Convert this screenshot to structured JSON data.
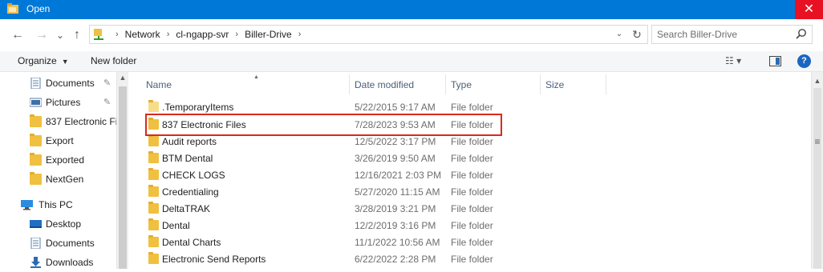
{
  "window": {
    "title": "Open",
    "close_glyph": "✕"
  },
  "nav": {
    "back_glyph": "←",
    "forward_glyph": "→",
    "recent_glyph": "⌄",
    "up_glyph": "↑",
    "breadcrumb": [
      "Network",
      "cl-ngapp-svr",
      "Biller-Drive"
    ],
    "breadcrumb_sep": "›",
    "dropdown_glyph": "⌄",
    "refresh_glyph": "↻"
  },
  "search": {
    "placeholder": "Search Biller-Drive"
  },
  "toolbar": {
    "organize_label": "Organize",
    "organize_caret": "▼",
    "new_folder_label": "New folder",
    "views_label": "☷ ▾",
    "help_label": "?"
  },
  "navpane": {
    "pin_glyph": "✎",
    "items": [
      {
        "label": "Documents",
        "icon": "documents-icon",
        "pinned": true
      },
      {
        "label": "Pictures",
        "icon": "pictures-icon",
        "pinned": true
      },
      {
        "label": "837 Electronic Fi",
        "icon": "folder-icon",
        "pinned": false
      },
      {
        "label": "Export",
        "icon": "folder-icon",
        "pinned": false
      },
      {
        "label": "Exported",
        "icon": "folder-icon",
        "pinned": false
      },
      {
        "label": "NextGen",
        "icon": "folder-icon",
        "pinned": false
      },
      {
        "label": "This PC",
        "icon": "computer-icon",
        "pinned": false
      },
      {
        "label": "Desktop",
        "icon": "desktop-icon",
        "pinned": false
      },
      {
        "label": "Documents",
        "icon": "documents-icon",
        "pinned": false
      },
      {
        "label": "Downloads",
        "icon": "downloads-icon",
        "pinned": false
      }
    ]
  },
  "columns": {
    "name": "Name",
    "date": "Date modified",
    "type": "Type",
    "size": "Size",
    "sort_caret": "▲"
  },
  "files": [
    {
      "name": ".TemporaryItems",
      "date": "5/22/2015 9:17 AM",
      "type": "File folder"
    },
    {
      "name": "837 Electronic Files",
      "date": "7/28/2023 9:53 AM",
      "type": "File folder",
      "highlighted": true
    },
    {
      "name": "Audit reports",
      "date": "12/5/2022 3:17 PM",
      "type": "File folder"
    },
    {
      "name": "BTM Dental",
      "date": "3/26/2019 9:50 AM",
      "type": "File folder"
    },
    {
      "name": "CHECK LOGS",
      "date": "12/16/2021 2:03 PM",
      "type": "File folder"
    },
    {
      "name": "Credentialing",
      "date": "5/27/2020 11:15 AM",
      "type": "File folder"
    },
    {
      "name": "DeltaTRAK",
      "date": "3/28/2019 3:21 PM",
      "type": "File folder"
    },
    {
      "name": "Dental",
      "date": "12/2/2019 3:16 PM",
      "type": "File folder"
    },
    {
      "name": "Dental Charts",
      "date": "11/1/2022 10:56 AM",
      "type": "File folder"
    },
    {
      "name": "Electronic Send Reports",
      "date": "6/22/2022 2:28 PM",
      "type": "File folder"
    }
  ],
  "scroll": {
    "up_glyph": "▲",
    "grip_glyph": "≡"
  },
  "colors": {
    "titlebar": "#0078d7",
    "close": "#e81123",
    "folder": "#f0c040",
    "highlight": "#d9291c"
  }
}
